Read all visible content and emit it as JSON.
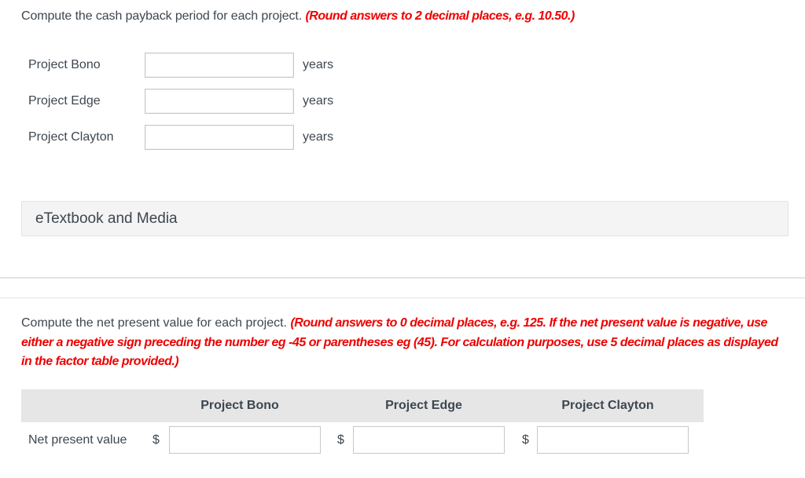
{
  "payback": {
    "prompt": "Compute the cash payback period for each project.",
    "instruction": "(Round answers to 2 decimal places, e.g. 10.50.)",
    "rows": [
      {
        "label": "Project Bono",
        "value": "",
        "unit": "years"
      },
      {
        "label": "Project Edge",
        "value": "",
        "unit": "years"
      },
      {
        "label": "Project Clayton",
        "value": "",
        "unit": "years"
      }
    ]
  },
  "etextbook": {
    "label": "eTextbook and Media"
  },
  "npv": {
    "prompt": "Compute the net present value for each project.",
    "instruction": "(Round answers to 0 decimal places, e.g. 125.  If the net present value is negative, use either a negative sign preceding the number eg -45 or parentheses eg (45). For calculation purposes, use 5 decimal places as displayed in the factor table provided.)",
    "columns": [
      "Project Bono",
      "Project Edge",
      "Project Clayton"
    ],
    "row_label": "Net present value",
    "currency_symbol": "$",
    "values": [
      "",
      "",
      ""
    ]
  }
}
